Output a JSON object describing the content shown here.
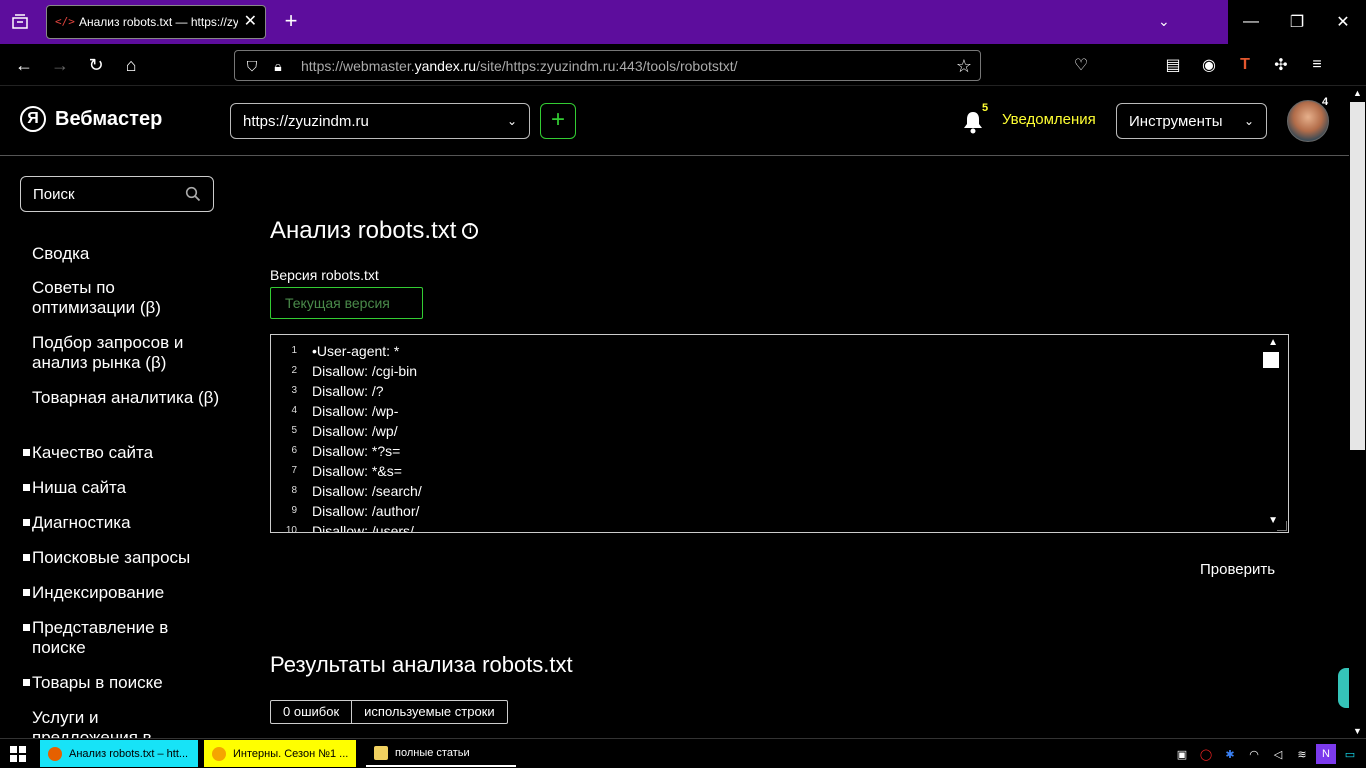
{
  "browser": {
    "tab_title": "Анализ robots.txt — https://zyuzindm.ru",
    "tab_favicon": "</>",
    "url_prefix": "https://webmaster.",
    "url_domain": "yandex.ru",
    "url_path": "/site/https:zyuzindm.ru:443/tools/robotstxt/"
  },
  "header": {
    "logo_letter": "Я",
    "logo_text": "Вебмастер",
    "site_value": "https://zyuzindm.ru",
    "add_label": "+",
    "notif_count": "5",
    "notif_label": "Уведомления",
    "tools_label": "Инструменты",
    "avatar_count": "4"
  },
  "sidebar": {
    "search_placeholder": "Поиск",
    "items": [
      {
        "label": "Сводка",
        "bullet": false
      },
      {
        "label": "Советы по оптимизации (β)",
        "bullet": false
      },
      {
        "label": "Подбор запросов и анализ рынка (β)",
        "bullet": false
      },
      {
        "label": "Товарная аналитика (β)",
        "bullet": false
      },
      {
        "label": "Качество сайта",
        "bullet": true
      },
      {
        "label": "Ниша сайта",
        "bullet": true
      },
      {
        "label": "Диагностика",
        "bullet": true
      },
      {
        "label": "Поисковые запросы",
        "bullet": true
      },
      {
        "label": "Индексирование",
        "bullet": true
      },
      {
        "label": "Представление в поиске",
        "bullet": true
      },
      {
        "label": "Товары в поиске",
        "bullet": true
      },
      {
        "label": "Услуги и предложения в",
        "bullet": true
      }
    ]
  },
  "main": {
    "title": "Анализ robots.txt",
    "version_label": "Версия robots.txt",
    "version_value": "Текущая версия",
    "editor_lines": [
      {
        "n": "1",
        "text": "•User-agent: *"
      },
      {
        "n": "2",
        "text": "Disallow: /cgi-bin"
      },
      {
        "n": "3",
        "text": "Disallow: /?"
      },
      {
        "n": "4",
        "text": "Disallow: /wp-"
      },
      {
        "n": "5",
        "text": "Disallow: /wp/"
      },
      {
        "n": "6",
        "text": "Disallow: *?s="
      },
      {
        "n": "7",
        "text": "Disallow: *&s="
      },
      {
        "n": "8",
        "text": "Disallow: /search/"
      },
      {
        "n": "9",
        "text": "Disallow: /author/"
      },
      {
        "n": "10",
        "text": "Disallow: /users/"
      }
    ],
    "check_label": "Проверить",
    "results_title": "Результаты анализа robots.txt",
    "results_tabs": [
      "0 ошибок",
      "используемые строки"
    ]
  },
  "taskbar": {
    "tasks": [
      {
        "label": "Анализ robots.txt – htt..."
      },
      {
        "label": "Интерны. Сезон №1 ..."
      },
      {
        "label": "полные статьи"
      }
    ]
  },
  "colors": {
    "tabbar": "#5d0d9d",
    "accent_green": "#33cc33",
    "notif_yellow": "#ffff33",
    "task_cyan": "#17e3f7",
    "task_yellow": "#ffff00"
  }
}
